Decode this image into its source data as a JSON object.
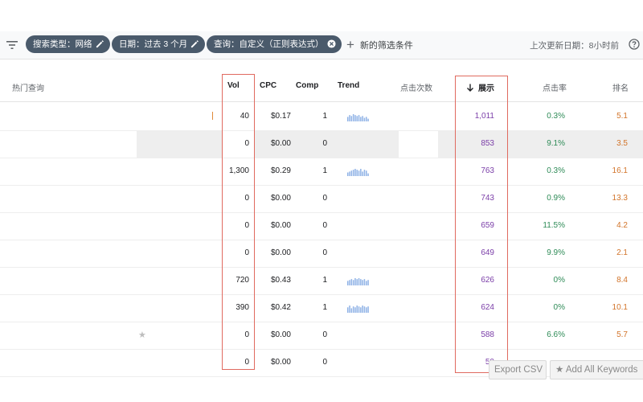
{
  "filters": {
    "chips": [
      {
        "label": "搜索类型：网络",
        "icon": "edit-icon"
      },
      {
        "label": "日期：过去 3 个月",
        "icon": "edit-icon"
      },
      {
        "label": "查询：自定义（正则表达式）",
        "icon": "close-circle-icon"
      }
    ],
    "add_filter_label": "新的筛选条件",
    "last_updated": "上次更新日期：8小时前"
  },
  "table": {
    "headers": {
      "query": "热门查询",
      "vol": "Vol",
      "cpc": "CPC",
      "comp": "Comp",
      "trend": "Trend",
      "clicks": "点击次数",
      "impressions": "展示",
      "ctr": "点击率",
      "position": "排名"
    },
    "sort": {
      "column": "impressions",
      "direction": "desc"
    },
    "rows": [
      {
        "vol": "40",
        "cpc": "$0.17",
        "comp": "1",
        "trend": [
          5,
          7,
          6,
          8,
          7,
          6,
          7,
          5,
          6,
          4,
          5,
          3
        ],
        "impressions": "1,011",
        "ctr": "0.3%",
        "position": "5.1"
      },
      {
        "vol": "0",
        "cpc": "$0.00",
        "comp": "0",
        "trend": null,
        "impressions": "853",
        "ctr": "9.1%",
        "position": "3.5"
      },
      {
        "vol": "1,300",
        "cpc": "$0.29",
        "comp": "1",
        "trend": [
          4,
          5,
          6,
          7,
          8,
          7,
          6,
          8,
          5,
          7,
          6,
          3
        ],
        "impressions": "763",
        "ctr": "0.3%",
        "position": "16.1"
      },
      {
        "vol": "0",
        "cpc": "$0.00",
        "comp": "0",
        "trend": null,
        "impressions": "743",
        "ctr": "0.9%",
        "position": "13.3"
      },
      {
        "vol": "0",
        "cpc": "$0.00",
        "comp": "0",
        "trend": null,
        "impressions": "659",
        "ctr": "11.5%",
        "position": "4.2"
      },
      {
        "vol": "0",
        "cpc": "$0.00",
        "comp": "0",
        "trend": null,
        "impressions": "649",
        "ctr": "9.9%",
        "position": "2.1"
      },
      {
        "vol": "720",
        "cpc": "$0.43",
        "comp": "1",
        "trend": [
          5,
          6,
          7,
          6,
          8,
          7,
          8,
          7,
          6,
          7,
          5,
          6
        ],
        "impressions": "626",
        "ctr": "0%",
        "position": "8.4"
      },
      {
        "vol": "390",
        "cpc": "$0.42",
        "comp": "1",
        "trend": [
          6,
          8,
          5,
          7,
          6,
          8,
          7,
          6,
          8,
          7,
          6,
          7
        ],
        "impressions": "624",
        "ctr": "0%",
        "position": "10.1"
      },
      {
        "vol": "0",
        "cpc": "$0.00",
        "comp": "0",
        "trend": null,
        "impressions": "588",
        "ctr": "6.6%",
        "position": "5.7"
      },
      {
        "vol": "0",
        "cpc": "$0.00",
        "comp": "0",
        "trend": null,
        "impressions": "50",
        "ctr": "",
        "position": ""
      }
    ]
  },
  "buttons": {
    "export_csv": "Export CSV",
    "add_all_keywords": "★ Add All Keywords"
  },
  "colors": {
    "chip_bg": "#4a5a6b",
    "impressions": "#7b3ea8",
    "ctr": "#2e8b57",
    "position": "#d2742a",
    "annotation_box": "#e06a5f",
    "sparkline": "#8fb2e6"
  }
}
